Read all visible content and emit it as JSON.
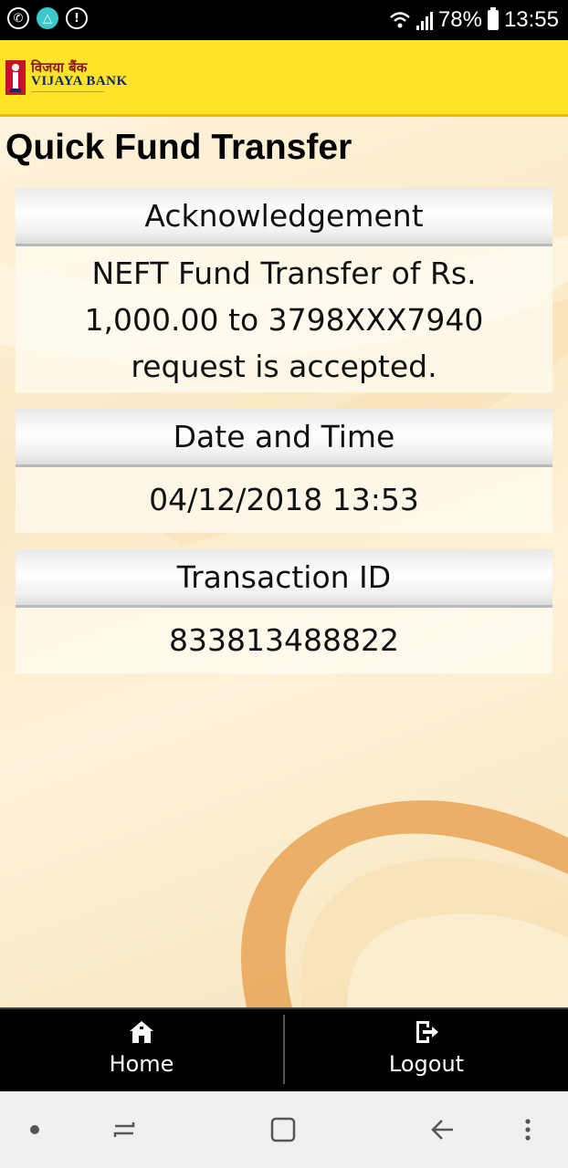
{
  "status_bar": {
    "battery_pct": "78%",
    "time": "13:55",
    "left_icons": [
      "whatsapp-icon",
      "app-notification-icon",
      "alert-icon"
    ]
  },
  "header": {
    "logo_hindi": "विजया बैंक",
    "logo_name": "VIJAYA BANK"
  },
  "page": {
    "title": "Quick Fund Transfer"
  },
  "sections": {
    "ack": {
      "label": "Acknowledgement",
      "value": "NEFT Fund Transfer of Rs. 1,000.00 to 3798XXX7940 request is accepted."
    },
    "datetime": {
      "label": "Date and Time",
      "value": "04/12/2018 13:53"
    },
    "txn": {
      "label": "Transaction ID",
      "value": "833813488822"
    }
  },
  "bottom_nav": {
    "home_label": "Home",
    "logout_label": "Logout"
  },
  "colors": {
    "header_bg": "#ffe328",
    "brand_red": "#c8102e",
    "brand_blue": "#0b2a6a"
  }
}
